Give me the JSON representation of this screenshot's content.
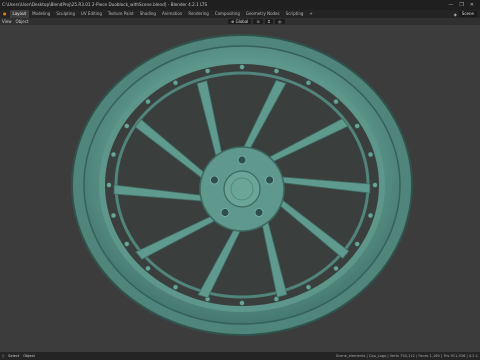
{
  "window": {
    "title": "C:\\Users\\User\\Desktop\\BlendProj\\25.R3.01 2-Piece Duoblock_withScene.blend] - Blender 4.2.1 LTS",
    "controls": [
      "—",
      "❐",
      "✕"
    ]
  },
  "workspaces": {
    "tabs": [
      "Layout",
      "Modeling",
      "Sculpting",
      "UV Editing",
      "Texture Paint",
      "Shading",
      "Animation",
      "Rendering",
      "Compositing",
      "Geometry Nodes",
      "Scripting",
      "+"
    ],
    "active": "Layout",
    "scene_label": "Scene"
  },
  "menubar": {
    "items": [
      "View",
      "Object"
    ]
  },
  "header_tools": {
    "transform": "Global"
  },
  "statusbar": {
    "left": [
      "Select",
      "Object"
    ],
    "stats": "Scene_elements | Cap_Logo | Verts 750,112 | Faces 1,160 | Tris 911,936 | 4.2.1"
  },
  "colors": {
    "wheel": "#5f9a8f",
    "wheel_dark": "#3f6e66",
    "viewport": "#3c3c3c"
  }
}
